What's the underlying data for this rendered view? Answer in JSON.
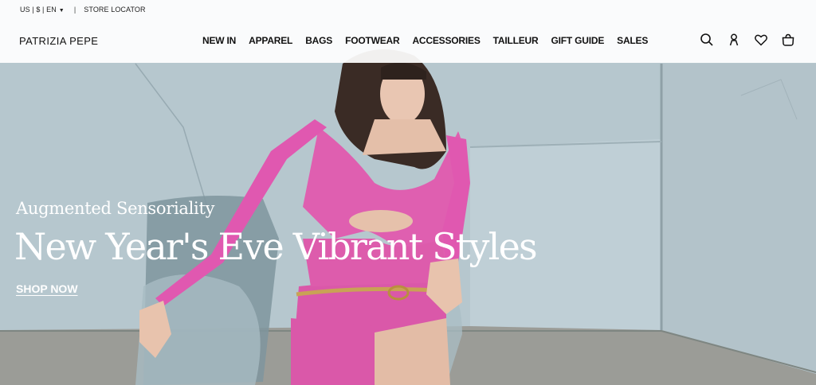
{
  "topbar": {
    "locale": "US | $ | EN",
    "store_locator": "STORE LOCATOR"
  },
  "brand": {
    "logo": "PATRIZIA PEPE"
  },
  "nav": {
    "items": [
      "NEW IN",
      "APPAREL",
      "BAGS",
      "FOOTWEAR",
      "ACCESSORIES",
      "TAILLEUR",
      "GIFT GUIDE",
      "SALES"
    ]
  },
  "header_icons": [
    "search-icon",
    "account-icon",
    "wishlist-heart-icon",
    "shopping-bag-icon"
  ],
  "hero": {
    "kicker": "Augmented Sensoriality",
    "headline": "New Year's Eve Vibrant Styles",
    "cta": "SHOP NOW"
  },
  "colors": {
    "dress_pink": "#df5fb0",
    "wall": "#b7c7ce",
    "floor": "#9a9a94"
  }
}
